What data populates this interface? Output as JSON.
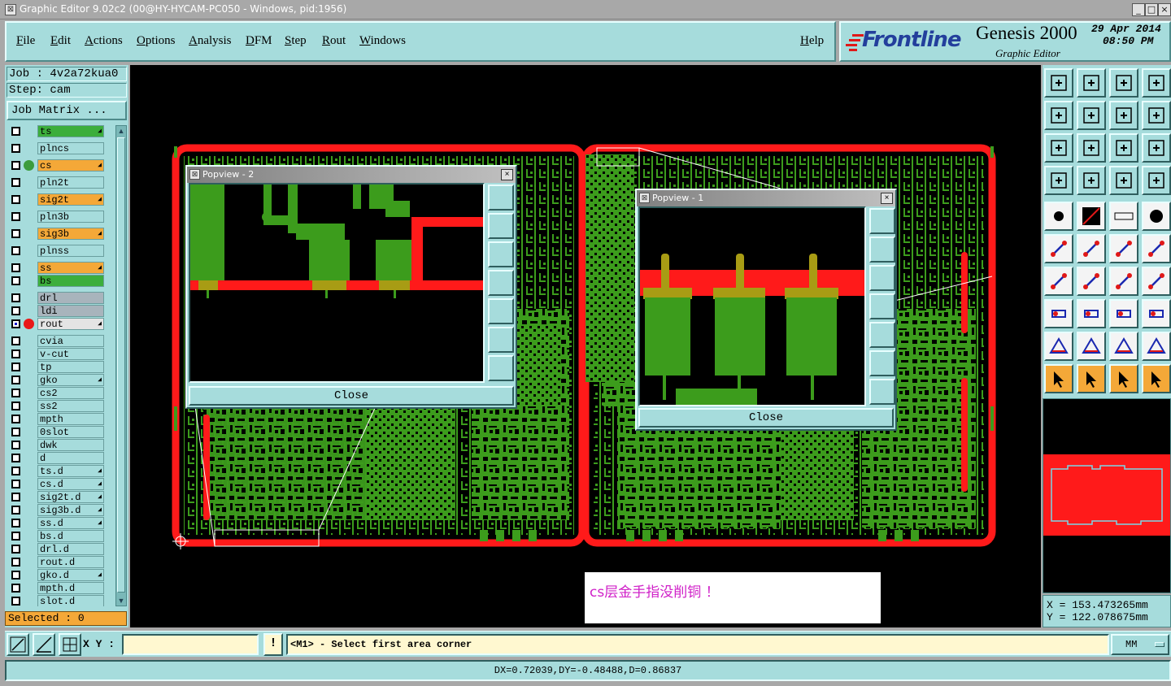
{
  "window": {
    "title": "Graphic Editor 9.02c2 (00@HY-HYCAM-PC050 - Windows, pid:1956)",
    "minimize": "_",
    "maximize": "□",
    "close": "×"
  },
  "menu": {
    "items": [
      "File",
      "Edit",
      "Actions",
      "Options",
      "Analysis",
      "DFM",
      "Step",
      "Rout",
      "Windows"
    ],
    "help": "Help"
  },
  "brand": {
    "logo": "Frontline",
    "product": "Genesis 2000",
    "subtitle": "Graphic Editor",
    "date": "29 Apr 2014",
    "time": "08:50 PM"
  },
  "left": {
    "job": "Job : 4v2a72kua0",
    "step": "Step: cam",
    "job_matrix": "Job Matrix ...",
    "selected": "Selected : 0"
  },
  "layers": [
    {
      "name": "ts",
      "color": "#3cae3c",
      "dot": "",
      "arrow": true,
      "checked": false
    },
    {
      "name": "plncs",
      "color": "#a6dcdc",
      "dot": "",
      "arrow": false,
      "checked": false
    },
    {
      "name": "cs",
      "color": "#f4a838",
      "dot": "#3c9c3c",
      "arrow": true,
      "checked": false
    },
    {
      "name": "pln2t",
      "color": "#a6dcdc",
      "dot": "",
      "arrow": false,
      "checked": false
    },
    {
      "name": "sig2t",
      "color": "#f4a838",
      "dot": "",
      "arrow": true,
      "checked": false
    },
    {
      "name": "pln3b",
      "color": "#a6dcdc",
      "dot": "",
      "arrow": false,
      "checked": false
    },
    {
      "name": "sig3b",
      "color": "#f4a838",
      "dot": "",
      "arrow": true,
      "checked": false
    },
    {
      "name": "plnss",
      "color": "#a6dcdc",
      "dot": "",
      "arrow": false,
      "checked": false
    },
    {
      "name": "ss",
      "color": "#f4a838",
      "dot": "",
      "arrow": true,
      "checked": false
    },
    {
      "name": "bs",
      "color": "#3cae3c",
      "dot": "",
      "arrow": false,
      "checked": false
    },
    {
      "name": "drl",
      "color": "#a8b4bc",
      "dot": "",
      "arrow": false,
      "checked": false
    },
    {
      "name": "ldi",
      "color": "#a8b4bc",
      "dot": "",
      "arrow": false,
      "checked": false
    },
    {
      "name": "rout",
      "color": "#e4e4e4",
      "dot": "#e81818",
      "arrow": true,
      "checked": true
    },
    {
      "name": "cvia",
      "color": "#a6dcdc",
      "dot": "",
      "arrow": false,
      "checked": false
    },
    {
      "name": "v-cut",
      "color": "#a6dcdc",
      "dot": "",
      "arrow": false,
      "checked": false
    },
    {
      "name": "tp",
      "color": "#a6dcdc",
      "dot": "",
      "arrow": false,
      "checked": false
    },
    {
      "name": "gko",
      "color": "#a6dcdc",
      "dot": "",
      "arrow": true,
      "checked": false
    },
    {
      "name": "cs2",
      "color": "#a6dcdc",
      "dot": "",
      "arrow": false,
      "checked": false
    },
    {
      "name": "ss2",
      "color": "#a6dcdc",
      "dot": "",
      "arrow": false,
      "checked": false
    },
    {
      "name": "mpth",
      "color": "#a6dcdc",
      "dot": "",
      "arrow": false,
      "checked": false
    },
    {
      "name": "0slot",
      "color": "#a6dcdc",
      "dot": "",
      "arrow": false,
      "checked": false
    },
    {
      "name": "dwk",
      "color": "#a6dcdc",
      "dot": "",
      "arrow": false,
      "checked": false
    },
    {
      "name": "d",
      "color": "#a6dcdc",
      "dot": "",
      "arrow": false,
      "checked": false
    },
    {
      "name": "ts.d",
      "color": "#a6dcdc",
      "dot": "",
      "arrow": true,
      "checked": false
    },
    {
      "name": "cs.d",
      "color": "#a6dcdc",
      "dot": "",
      "arrow": true,
      "checked": false
    },
    {
      "name": "sig2t.d",
      "color": "#a6dcdc",
      "dot": "",
      "arrow": true,
      "checked": false
    },
    {
      "name": "sig3b.d",
      "color": "#a6dcdc",
      "dot": "",
      "arrow": true,
      "checked": false
    },
    {
      "name": "ss.d",
      "color": "#a6dcdc",
      "dot": "",
      "arrow": true,
      "checked": false
    },
    {
      "name": "bs.d",
      "color": "#a6dcdc",
      "dot": "",
      "arrow": false,
      "checked": false
    },
    {
      "name": "drl.d",
      "color": "#a6dcdc",
      "dot": "",
      "arrow": false,
      "checked": false
    },
    {
      "name": "rout.d",
      "color": "#a6dcdc",
      "dot": "",
      "arrow": false,
      "checked": false
    },
    {
      "name": "gko.d",
      "color": "#a6dcdc",
      "dot": "",
      "arrow": true,
      "checked": false
    },
    {
      "name": "mpth.d",
      "color": "#a6dcdc",
      "dot": "",
      "arrow": false,
      "checked": false
    },
    {
      "name": "slot.d",
      "color": "#a6dcdc",
      "dot": "",
      "arrow": false,
      "checked": false
    }
  ],
  "popview2": {
    "title": "Popview - 2",
    "close_label": "Close",
    "close_x": "×"
  },
  "popview1": {
    "title": "Popview - 1",
    "close_label": "Close",
    "close_x": "×"
  },
  "note": {
    "text": "cs层金手指没削铜 ！"
  },
  "coords": {
    "x": "X = 153.473265mm",
    "y": "Y = 122.078675mm"
  },
  "command": {
    "xy_label": "X Y :",
    "xy_value": "",
    "excl": "!",
    "prompt": "<M1> - Select first area corner",
    "units": "MM"
  },
  "status": {
    "text": "DX=0.72039,DY=-0.48488,D=0.86837"
  },
  "colors": {
    "copper": "#3c9c1c",
    "rout": "#ff1a1a",
    "panel": "#a6dcdc",
    "accent_orange": "#f4a838"
  }
}
